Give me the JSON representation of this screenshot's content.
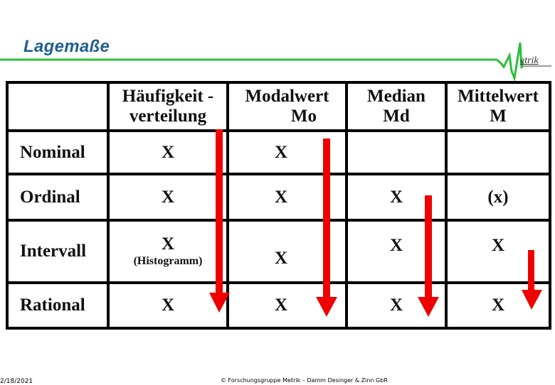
{
  "slide": {
    "title": "Lagemaße",
    "logo_text": "etrik",
    "footer": {
      "date": "2/18/2021",
      "copyright": "© Forschungsgruppe Metrik – Damm Desinger & Zinn GbR"
    },
    "colors": {
      "title": "#1f5f8f",
      "accent_line": "#2bbf3a",
      "arrow": "#ee0000"
    }
  },
  "table": {
    "columns": [
      {
        "label": ""
      },
      {
        "label": "Häufigkeit -",
        "label2": "verteilung"
      },
      {
        "label": "Modalwert",
        "label2": "Mo"
      },
      {
        "label": "Median",
        "label2": "Md"
      },
      {
        "label": "Mittelwert",
        "label2": "M"
      }
    ],
    "rows": [
      {
        "label": "Nominal",
        "cells": [
          "X",
          "X",
          "",
          ""
        ]
      },
      {
        "label": "Ordinal",
        "cells": [
          "X",
          "X",
          "X",
          "(x)"
        ]
      },
      {
        "label": "Intervall",
        "cells": [
          "X",
          "X",
          "X",
          "X"
        ],
        "note": "(Histogramm)"
      },
      {
        "label": "Rational",
        "cells": [
          "X",
          "X",
          "X",
          "X"
        ]
      }
    ]
  },
  "arrows": [
    {
      "name": "arrow-haeufigkeit",
      "from_row": "Nominal",
      "to_row": "Rational"
    },
    {
      "name": "arrow-modalwert",
      "from_row": "Nominal",
      "to_row": "Rational"
    },
    {
      "name": "arrow-median",
      "from_row": "Ordinal",
      "to_row": "Rational"
    },
    {
      "name": "arrow-mittelwert",
      "from_row": "Intervall",
      "to_row": "Rational"
    }
  ]
}
